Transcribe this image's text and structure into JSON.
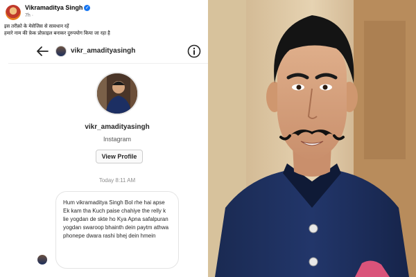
{
  "facebook_post": {
    "author": "Vikramaditya Singh",
    "time": "7h ·",
    "text_line1": "इस तरीक़ो के मेसेजिस से सावधान रहें",
    "text_line2": "हमारे नाम की फ़ेक प्रोफ़ाइल बनाकर दुरुपयोग किया जा रहा है"
  },
  "instagram": {
    "topbar_username": "vikr_amadityasingh",
    "profile_username": "vikr_amadityasingh",
    "platform": "Instagram",
    "view_profile_label": "View Profile",
    "timestamp": "Today 8:11 AM",
    "message": "Hum vikramaditya Singh Bol rhe hai apse Ek kam tha Kuch paise chahiye the relly k lie yogdan de skte ho Kya Apna safalpuran yogdan swaroop bhainth dein paytm athwa phonepe dwara rashi bhej dein hmein"
  },
  "icons": {
    "back": "back-arrow-icon",
    "info": "info-icon",
    "verified": "verified-badge-icon"
  }
}
